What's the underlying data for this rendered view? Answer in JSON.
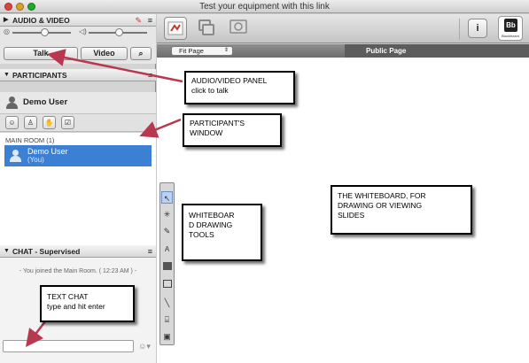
{
  "window": {
    "title": "Test your equipment with this link"
  },
  "audio_video": {
    "header": "AUDIO & VIDEO",
    "talk_label": "Talk",
    "video_label": "Video"
  },
  "participants": {
    "header": "PARTICIPANTS",
    "current_user": "Demo User",
    "room_label": "MAIN ROOM (1)",
    "list": [
      {
        "name": "Demo User",
        "sub": "(You)"
      }
    ]
  },
  "chat": {
    "header": "CHAT - Supervised",
    "messages": [
      "- You joined the Main Room. ( 12:23 AM ) -"
    ]
  },
  "toolbar": {
    "fit_page": "Fit Page",
    "public_page": "Public Page",
    "bb_label": "Blackboard"
  },
  "callouts": {
    "av_title": "AUDIO/VIDEO PANEL",
    "av_sub": "click to talk",
    "participants_l1": "PARTICIPANT'S",
    "participants_l2": "WINDOW",
    "tools_l1": "WHITEBOAR",
    "tools_l2": "D DRAWING",
    "tools_l3": "TOOLS",
    "wb_l1": "THE WHITEBOARD, FOR",
    "wb_l2": "DRAWING OR VIEWING",
    "wb_l3": "SLIDES",
    "chat_title": "TEXT CHAT",
    "chat_sub": "type and hit enter"
  },
  "colors": {
    "accent_arrow": "#b8384f",
    "selected_row": "#3c80d4"
  }
}
